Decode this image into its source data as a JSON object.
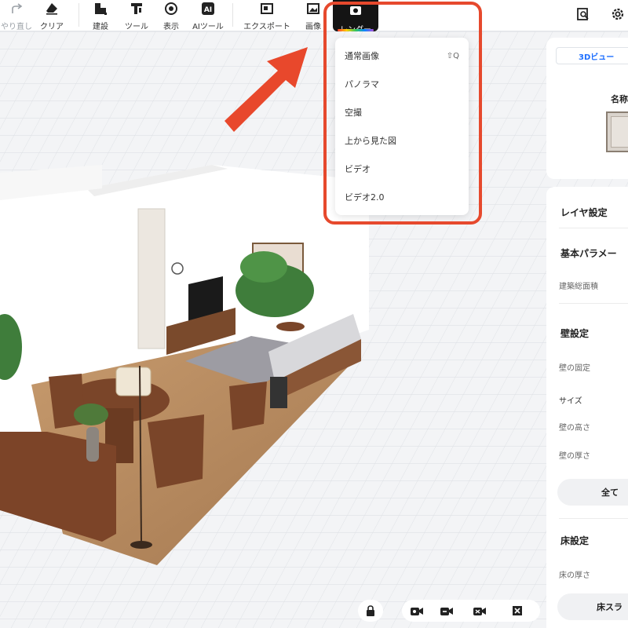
{
  "toolbar": {
    "tools": [
      {
        "label": "やり直し",
        "icon": "redo-icon",
        "disabled": true
      },
      {
        "label": "クリア",
        "icon": "clear-icon"
      },
      {
        "label": "建設",
        "icon": "build-icon"
      },
      {
        "label": "ツール",
        "icon": "tools-icon"
      },
      {
        "label": "表示",
        "icon": "view-icon"
      },
      {
        "label": "AIツール",
        "icon": "ai-tools-icon",
        "badge": ""
      },
      {
        "label": "エクスポート",
        "icon": "export-icon"
      },
      {
        "label": "画像",
        "icon": "image-icon"
      }
    ],
    "render_label": "レンダー",
    "right_icons": [
      "search-document-icon",
      "settings-icon"
    ]
  },
  "render_menu": {
    "items": [
      {
        "label": "通常画像",
        "shortcut": "⇧Q"
      },
      {
        "label": "パノラマ"
      },
      {
        "label": "空撮"
      },
      {
        "label": "上から見た図"
      },
      {
        "label": "ビデオ"
      },
      {
        "label": "ビデオ2.0"
      }
    ]
  },
  "preview_panel": {
    "tab_label": "3Dビュー",
    "name_label": "名称"
  },
  "layer_panel": {
    "title": "レイヤ設定",
    "basic_params": "基本パラメー",
    "building_area": "建築総面積",
    "wall_settings": "壁設定",
    "wall_fix": "壁の固定",
    "size": "サイズ",
    "wall_height": "壁の高さ",
    "wall_thickness": "壁の厚さ",
    "all_button": "全て",
    "floor_settings": "床設定",
    "floor_thickness": "床の厚さ",
    "floor_slab_button": "床スラ"
  },
  "view_controls": {
    "icons": [
      "lock-icon",
      "camera-view-1-icon",
      "camera-view-2-icon",
      "camera-view-3-icon",
      "fullscreen-icon"
    ]
  },
  "colors": {
    "highlight": "#e6492d",
    "arrow": "#e8482c",
    "accent_blue": "#1e6fff"
  }
}
